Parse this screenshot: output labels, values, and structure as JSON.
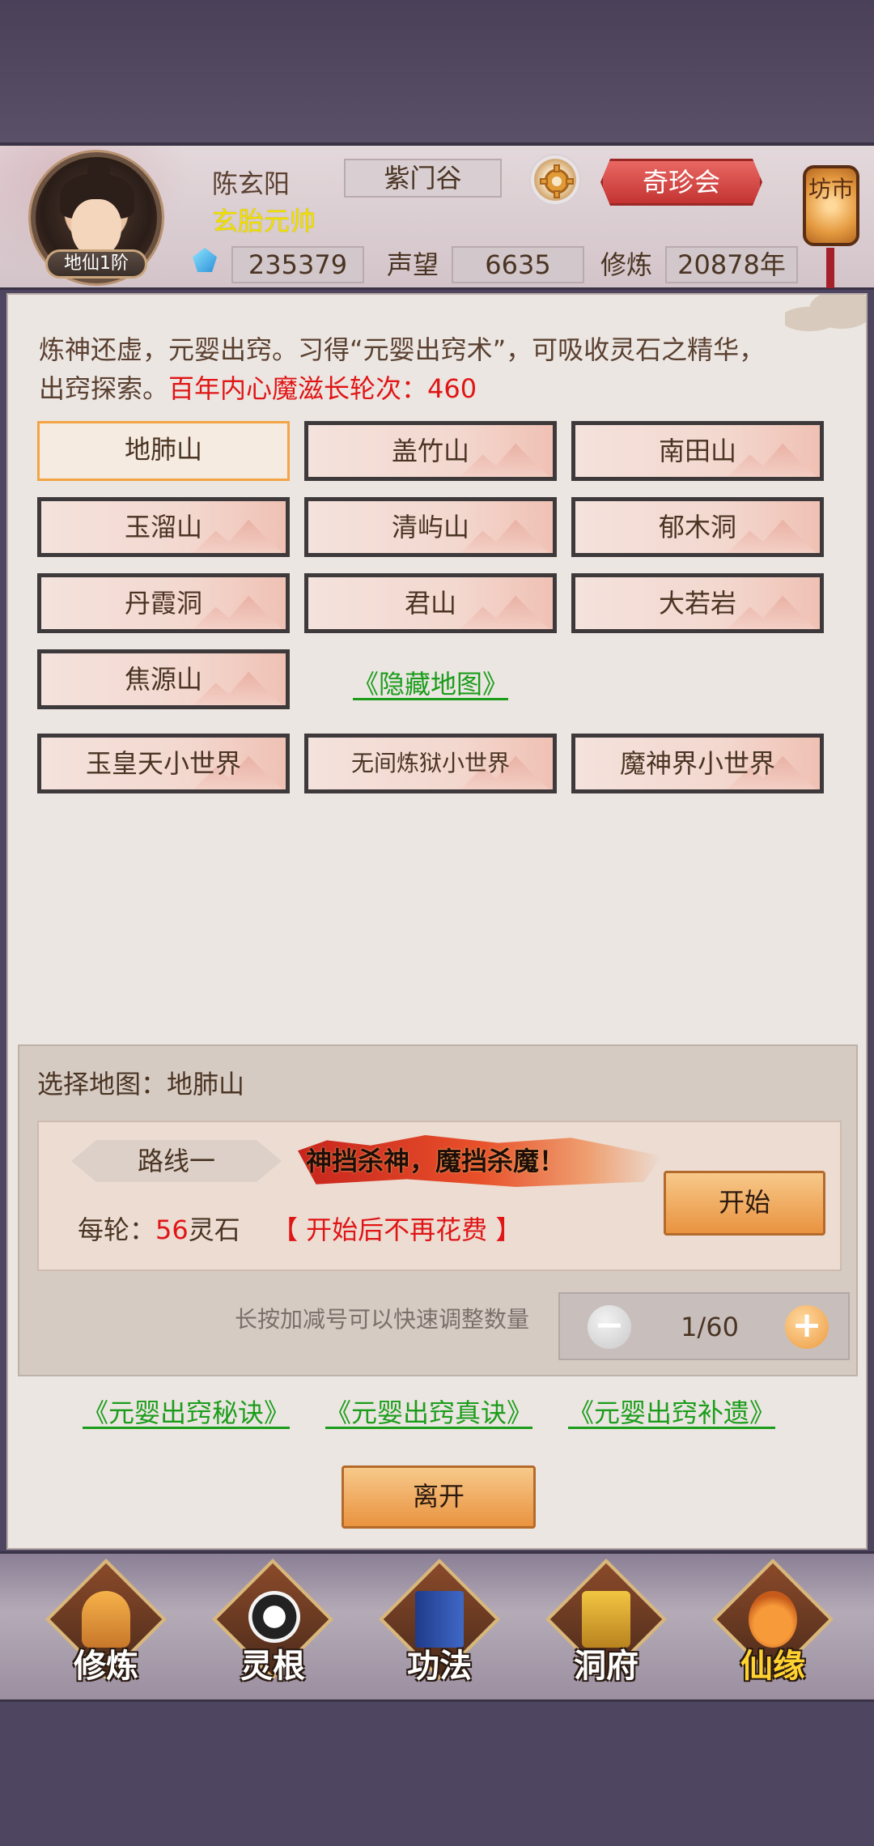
{
  "header": {
    "avatar_rank": "地仙1阶",
    "player_name": "陈玄阳",
    "player_title": "玄胎元帅",
    "sect": "紫门谷",
    "treasure_button": "奇珍会",
    "market_lantern": "坊市",
    "spirit_stones": "235379",
    "reputation_label": "声望",
    "reputation": "6635",
    "cultivation_label": "修炼",
    "cultivation": "20878年"
  },
  "intro": {
    "text": "炼神还虚，元婴出窍。习得“元婴出窍术”，可吸收灵石之精华，出窍探索。",
    "highlight": "百年内心魔滋长轮次：460"
  },
  "maps": [
    {
      "label": "地肺山",
      "selected": true
    },
    {
      "label": "盖竹山"
    },
    {
      "label": "南田山"
    },
    {
      "label": "玉溜山"
    },
    {
      "label": "清屿山"
    },
    {
      "label": "郁木洞"
    },
    {
      "label": "丹霞洞"
    },
    {
      "label": "君山"
    },
    {
      "label": "大若岩"
    },
    {
      "label": "焦源山"
    }
  ],
  "hidden_map_link": "《隐藏地图》",
  "worlds": [
    {
      "label": "玉皇天小世界"
    },
    {
      "label": "无间炼狱小世界"
    },
    {
      "label": "魔神界小世界"
    }
  ],
  "selection": {
    "title": "选择地图：地肺山",
    "route_name": "路线一",
    "slogan": "神挡杀神，魔挡杀魔！",
    "cost_prefix": "每轮：",
    "cost_value": "56",
    "cost_suffix": "灵石",
    "note": "【 开始后不再花费 】",
    "start_button": "开始",
    "hint": "长按加减号可以快速调整数量",
    "stepper_value": "1/60",
    "minus": "−",
    "plus": "+"
  },
  "guide_links": [
    "《元婴出窍秘诀》",
    "《元婴出窍真诀》",
    "《元婴出窍补遗》"
  ],
  "leave_button": "离开",
  "bottom_nav": [
    {
      "label": "修炼",
      "icon": "cultivate-icon"
    },
    {
      "label": "灵根",
      "icon": "spirit-root-icon"
    },
    {
      "label": "功法",
      "icon": "technique-book-icon"
    },
    {
      "label": "洞府",
      "icon": "cave-mansion-icon"
    },
    {
      "label": "仙缘",
      "icon": "immortal-fate-icon",
      "active": true
    }
  ]
}
